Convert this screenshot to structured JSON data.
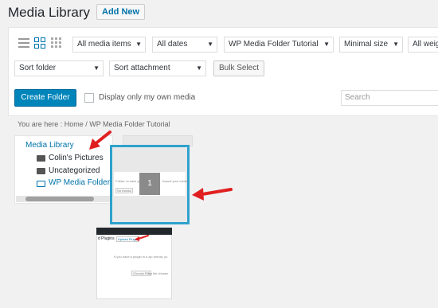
{
  "header": {
    "title": "Media Library",
    "add_new": "Add New"
  },
  "toolbar": {
    "filter_type": "All media items",
    "filter_date": "All dates",
    "filter_folder": "WP Media Folder Tutorial",
    "filter_size": "Minimal size",
    "filter_weight": "All weig",
    "sort_folder": "Sort folder",
    "sort_attachment": "Sort attachment",
    "bulk_select": "Bulk Select",
    "create_folder": "Create Folder",
    "own_media_label": "Display only my own media",
    "search_placeholder": "Search"
  },
  "breadcrumb": "You are here :  Home  /  WP Media Folder Tutorial",
  "tree": {
    "root": "Media Library",
    "items": [
      "Colin's Pictures",
      "Uncategorized",
      "WP Media Folder T"
    ]
  },
  "drag": {
    "count": "1",
    "thumb_text": "Folder, to save you...",
    "thumb_text2": "Import your media",
    "thumb_btn": "No thanks"
  },
  "preview": {
    "heading": "d Plugins",
    "link": "Upload Plugin",
    "body": "If you have a plugin in a zip format, yo",
    "choose": "Choose File",
    "nofile": "No file chosen"
  },
  "colors": {
    "accent": "#0085ba",
    "link": "#0073aa",
    "highlight": "#2ea2cc",
    "arrow": "#e02020"
  }
}
